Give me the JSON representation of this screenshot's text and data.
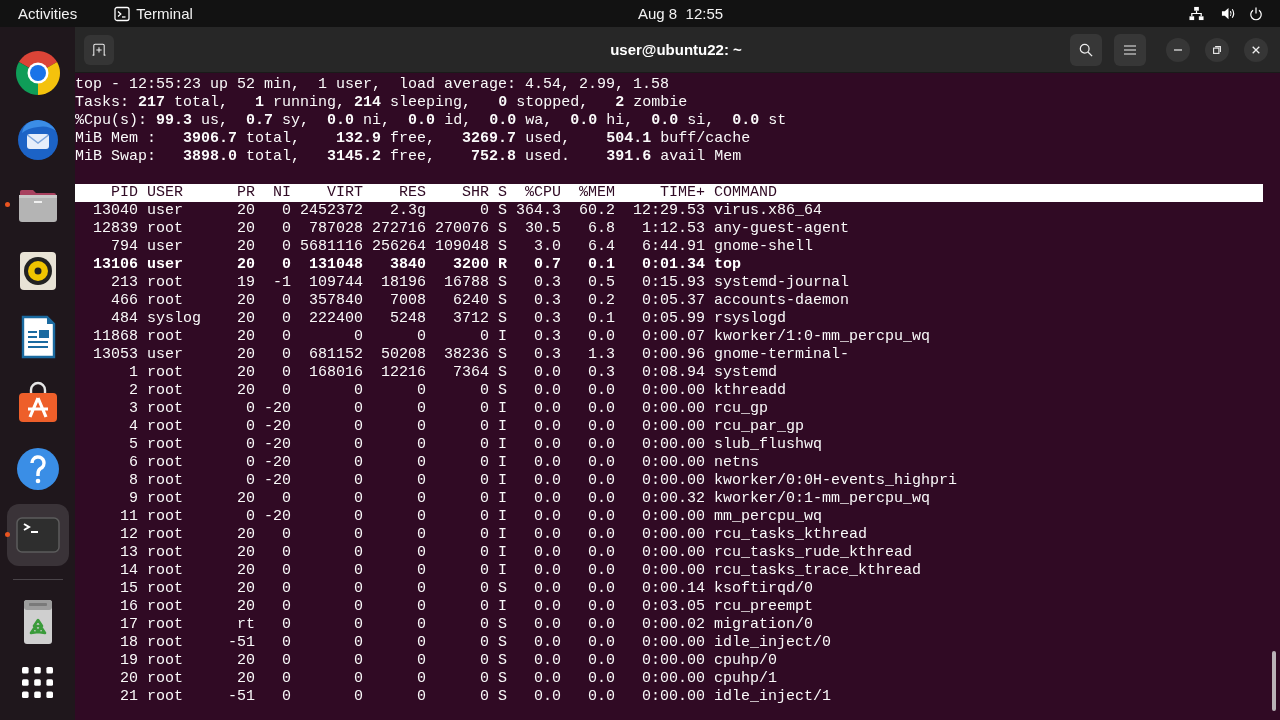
{
  "top_bar": {
    "activities": "Activities",
    "app_name": "Terminal",
    "clock": "Aug 8  12:55"
  },
  "dock": {
    "apps": [
      {
        "kind": "browser",
        "running": false,
        "selected": false
      },
      {
        "kind": "mail",
        "running": false,
        "selected": false
      },
      {
        "kind": "files",
        "running": true,
        "selected": false
      },
      {
        "kind": "music",
        "running": false,
        "selected": false
      },
      {
        "kind": "writer",
        "running": false,
        "selected": false
      },
      {
        "kind": "store",
        "running": false,
        "selected": false
      },
      {
        "kind": "help",
        "running": false,
        "selected": false
      },
      {
        "kind": "terminal",
        "running": true,
        "selected": true
      }
    ]
  },
  "window": {
    "title": "user@ubuntu22: ~"
  },
  "terminal": {
    "summary": [
      "top - 12:55:23 up 52 min,  1 user,  load average: 4.54, 2.99, 1.58",
      "Tasks: **217** total,   **1** running, **214** sleeping,   **0** stopped,   **2** zombie",
      "%Cpu(s): **99.3** us,  **0.7** sy,  **0.0** ni,  **0.0** id,  **0.0** wa,  **0.0** hi,  **0.0** si,  **0.0** st",
      "MiB Mem :   **3906.7** total,    **132.9** free,   **3269.7** used,    **504.1** buff/cache",
      "MiB Swap:   **3898.0** total,   **3145.2** free,    **752.8** used.    **391.6** avail Mem"
    ],
    "table": {
      "columns": [
        "PID",
        "USER",
        "PR",
        "NI",
        "VIRT",
        "RES",
        "SHR",
        "S",
        "%CPU",
        "%MEM",
        "TIME+",
        "COMMAND"
      ],
      "rows": [
        {
          "highlighted": false,
          "cells": [
            "13040",
            "user",
            "20",
            "0",
            "2452372",
            "2.3g",
            "0",
            "S",
            "364.3",
            "60.2",
            "12:29.53",
            "virus.x86_64"
          ]
        },
        {
          "highlighted": false,
          "cells": [
            "12839",
            "root",
            "20",
            "0",
            "787028",
            "272716",
            "270076",
            "S",
            "30.5",
            "6.8",
            "1:12.53",
            "any-guest-agent"
          ]
        },
        {
          "highlighted": false,
          "cells": [
            "794",
            "user",
            "20",
            "0",
            "5681116",
            "256264",
            "109048",
            "S",
            "3.0",
            "6.4",
            "6:44.91",
            "gnome-shell"
          ]
        },
        {
          "highlighted": true,
          "cells": [
            "13106",
            "user",
            "20",
            "0",
            "131048",
            "3840",
            "3200",
            "R",
            "0.7",
            "0.1",
            "0:01.34",
            "top"
          ]
        },
        {
          "highlighted": false,
          "cells": [
            "213",
            "root",
            "19",
            "-1",
            "109744",
            "18196",
            "16788",
            "S",
            "0.3",
            "0.5",
            "0:15.93",
            "systemd-journal"
          ]
        },
        {
          "highlighted": false,
          "cells": [
            "466",
            "root",
            "20",
            "0",
            "357840",
            "7008",
            "6240",
            "S",
            "0.3",
            "0.2",
            "0:05.37",
            "accounts-daemon"
          ]
        },
        {
          "highlighted": false,
          "cells": [
            "484",
            "syslog",
            "20",
            "0",
            "222400",
            "5248",
            "3712",
            "S",
            "0.3",
            "0.1",
            "0:05.99",
            "rsyslogd"
          ]
        },
        {
          "highlighted": false,
          "cells": [
            "11868",
            "root",
            "20",
            "0",
            "0",
            "0",
            "0",
            "I",
            "0.3",
            "0.0",
            "0:00.07",
            "kworker/1:0-mm_percpu_wq"
          ]
        },
        {
          "highlighted": false,
          "cells": [
            "13053",
            "user",
            "20",
            "0",
            "681152",
            "50208",
            "38236",
            "S",
            "0.3",
            "1.3",
            "0:00.96",
            "gnome-terminal-"
          ]
        },
        {
          "highlighted": false,
          "cells": [
            "1",
            "root",
            "20",
            "0",
            "168016",
            "12216",
            "7364",
            "S",
            "0.0",
            "0.3",
            "0:08.94",
            "systemd"
          ]
        },
        {
          "highlighted": false,
          "cells": [
            "2",
            "root",
            "20",
            "0",
            "0",
            "0",
            "0",
            "S",
            "0.0",
            "0.0",
            "0:00.00",
            "kthreadd"
          ]
        },
        {
          "highlighted": false,
          "cells": [
            "3",
            "root",
            "0",
            "-20",
            "0",
            "0",
            "0",
            "I",
            "0.0",
            "0.0",
            "0:00.00",
            "rcu_gp"
          ]
        },
        {
          "highlighted": false,
          "cells": [
            "4",
            "root",
            "0",
            "-20",
            "0",
            "0",
            "0",
            "I",
            "0.0",
            "0.0",
            "0:00.00",
            "rcu_par_gp"
          ]
        },
        {
          "highlighted": false,
          "cells": [
            "5",
            "root",
            "0",
            "-20",
            "0",
            "0",
            "0",
            "I",
            "0.0",
            "0.0",
            "0:00.00",
            "slub_flushwq"
          ]
        },
        {
          "highlighted": false,
          "cells": [
            "6",
            "root",
            "0",
            "-20",
            "0",
            "0",
            "0",
            "I",
            "0.0",
            "0.0",
            "0:00.00",
            "netns"
          ]
        },
        {
          "highlighted": false,
          "cells": [
            "8",
            "root",
            "0",
            "-20",
            "0",
            "0",
            "0",
            "I",
            "0.0",
            "0.0",
            "0:00.00",
            "kworker/0:0H-events_highpri"
          ]
        },
        {
          "highlighted": false,
          "cells": [
            "9",
            "root",
            "20",
            "0",
            "0",
            "0",
            "0",
            "I",
            "0.0",
            "0.0",
            "0:00.32",
            "kworker/0:1-mm_percpu_wq"
          ]
        },
        {
          "highlighted": false,
          "cells": [
            "11",
            "root",
            "0",
            "-20",
            "0",
            "0",
            "0",
            "I",
            "0.0",
            "0.0",
            "0:00.00",
            "mm_percpu_wq"
          ]
        },
        {
          "highlighted": false,
          "cells": [
            "12",
            "root",
            "20",
            "0",
            "0",
            "0",
            "0",
            "I",
            "0.0",
            "0.0",
            "0:00.00",
            "rcu_tasks_kthread"
          ]
        },
        {
          "highlighted": false,
          "cells": [
            "13",
            "root",
            "20",
            "0",
            "0",
            "0",
            "0",
            "I",
            "0.0",
            "0.0",
            "0:00.00",
            "rcu_tasks_rude_kthread"
          ]
        },
        {
          "highlighted": false,
          "cells": [
            "14",
            "root",
            "20",
            "0",
            "0",
            "0",
            "0",
            "I",
            "0.0",
            "0.0",
            "0:00.00",
            "rcu_tasks_trace_kthread"
          ]
        },
        {
          "highlighted": false,
          "cells": [
            "15",
            "root",
            "20",
            "0",
            "0",
            "0",
            "0",
            "S",
            "0.0",
            "0.0",
            "0:00.14",
            "ksoftirqd/0"
          ]
        },
        {
          "highlighted": false,
          "cells": [
            "16",
            "root",
            "20",
            "0",
            "0",
            "0",
            "0",
            "I",
            "0.0",
            "0.0",
            "0:03.05",
            "rcu_preempt"
          ]
        },
        {
          "highlighted": false,
          "cells": [
            "17",
            "root",
            "rt",
            "0",
            "0",
            "0",
            "0",
            "S",
            "0.0",
            "0.0",
            "0:00.02",
            "migration/0"
          ]
        },
        {
          "highlighted": false,
          "cells": [
            "18",
            "root",
            "-51",
            "0",
            "0",
            "0",
            "0",
            "S",
            "0.0",
            "0.0",
            "0:00.00",
            "idle_inject/0"
          ]
        },
        {
          "highlighted": false,
          "cells": [
            "19",
            "root",
            "20",
            "0",
            "0",
            "0",
            "0",
            "S",
            "0.0",
            "0.0",
            "0:00.00",
            "cpuhp/0"
          ]
        },
        {
          "highlighted": false,
          "cells": [
            "20",
            "root",
            "20",
            "0",
            "0",
            "0",
            "0",
            "S",
            "0.0",
            "0.0",
            "0:00.00",
            "cpuhp/1"
          ]
        },
        {
          "highlighted": false,
          "cells": [
            "21",
            "root",
            "-51",
            "0",
            "0",
            "0",
            "0",
            "S",
            "0.0",
            "0.0",
            "0:00.00",
            "idle_inject/1"
          ]
        }
      ]
    }
  }
}
